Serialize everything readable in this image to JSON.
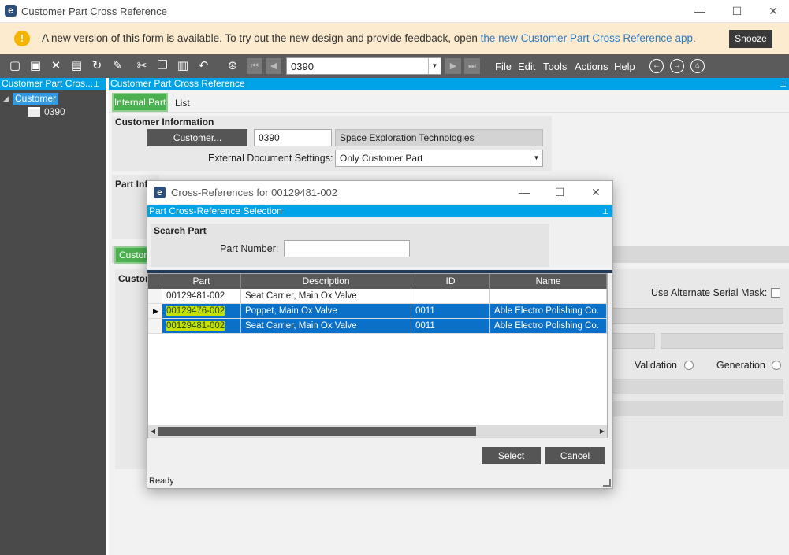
{
  "window": {
    "title": "Customer Part Cross Reference",
    "minimize": "—",
    "maximize": "☐",
    "close": "✕"
  },
  "banner": {
    "message": "A new version of this form is available. To try out the new design and provide feedback, open ",
    "link": "the new Customer Part Cross Reference app",
    "suffix": ".",
    "snooze": "Snooze"
  },
  "toolbar": {
    "key_value": "0390",
    "menu": [
      "File",
      "Edit",
      "Tools",
      "Actions",
      "Help"
    ]
  },
  "tree": {
    "panel_title": "Customer Part Cros...",
    "root": "Customer",
    "child": "0390"
  },
  "main": {
    "panel_title": "Customer Part Cross Reference",
    "tabs": [
      "Internal Part",
      "List"
    ],
    "customer_info": {
      "title": "Customer Information",
      "customer_button": "Customer...",
      "customer_id": "0390",
      "customer_name": "Space Exploration Technologies",
      "ext_doc_label": "External Document Settings:",
      "ext_doc_value": "Only Customer Part"
    },
    "part_info_title": "Part Info",
    "sub_tab": "Custom",
    "sub_group": "Custor",
    "alt_serial_label": "Use Alternate Serial Mask:",
    "validation_label": "Validation",
    "generation_label": "Generation"
  },
  "dialog": {
    "title": "Cross-References for 00129481-002",
    "panel_title": "Part Cross-Reference Selection",
    "search_title": "Search Part",
    "part_number_label": "Part Number:",
    "part_number_value": "",
    "columns": [
      "Part",
      "Description",
      "ID",
      "Name"
    ],
    "rows": [
      {
        "part": "00129481-002",
        "description": "Seat Carrier, Main Ox Valve",
        "id": "",
        "name": "",
        "selected": false
      },
      {
        "part": "00129476-002",
        "description": "Poppet, Main Ox Valve",
        "id": "0011",
        "name": "Able Electro Polishing Co.",
        "selected": true
      },
      {
        "part": "00129481-002",
        "description": "Seat Carrier, Main Ox Valve",
        "id": "0011",
        "name": "Able Electro Polishing Co.",
        "selected": true
      }
    ],
    "select_button": "Select",
    "cancel_button": "Cancel",
    "status": "Ready"
  },
  "colors": {
    "accent": "#00a2e8",
    "selection": "#0a70c8",
    "highlight": "#c8e000",
    "tab_active": "#4caf50"
  }
}
